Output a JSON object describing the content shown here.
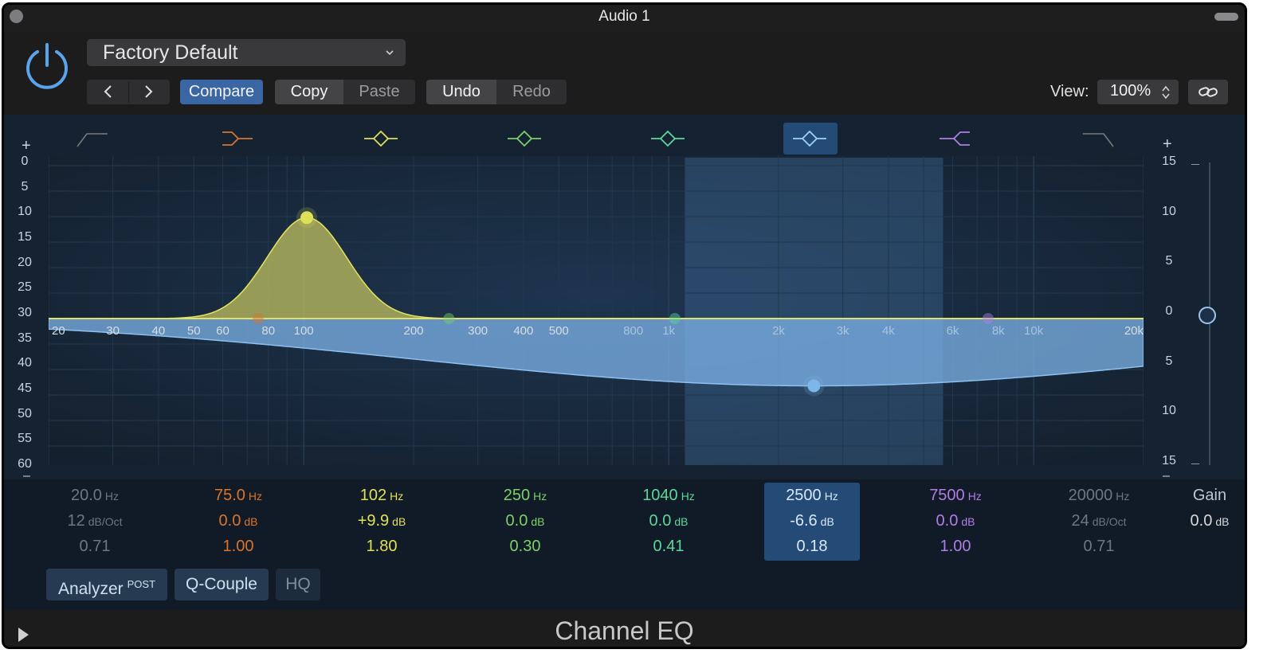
{
  "window": {
    "title": "Audio 1"
  },
  "header": {
    "preset": "Factory Default",
    "compare": "Compare",
    "copy": "Copy",
    "paste": "Paste",
    "undo": "Undo",
    "redo": "Redo",
    "view_label": "View:",
    "view_value": "100%"
  },
  "graph": {
    "plus_left": "+",
    "plus_right": "+",
    "minus_left": "–",
    "minus_right": "–",
    "left_scale": [
      "0",
      "5",
      "10",
      "15",
      "20",
      "25",
      "30",
      "35",
      "40",
      "45",
      "50",
      "55",
      "60"
    ],
    "right_scale": [
      "15",
      "10",
      "5",
      "0",
      "5",
      "10",
      "15"
    ],
    "freq_labels": [
      "20",
      "30",
      "40",
      "50",
      "60",
      "80",
      "100",
      "200",
      "300",
      "400",
      "500",
      "800",
      "1k",
      "2k",
      "3k",
      "4k",
      "6k",
      "8k",
      "10k",
      "20k"
    ],
    "freq_values": [
      20,
      30,
      40,
      50,
      60,
      80,
      100,
      200,
      300,
      400,
      500,
      800,
      1000,
      2000,
      3000,
      4000,
      6000,
      8000,
      10000,
      20000
    ],
    "selected_band": 6
  },
  "band_colors": [
    "#808080",
    "#d9742c",
    "#dfe05a",
    "#7bd169",
    "#5ed69b",
    "#7fb6ea",
    "#b07ee6",
    "#808080"
  ],
  "bands": [
    {
      "freq": "20.0",
      "freq_unit": "Hz",
      "gain": "12",
      "gain_unit": "dB/Oct",
      "q": "0.71",
      "freq_hz": 20,
      "gain_db": 0,
      "q_val": 0.71
    },
    {
      "freq": "75.0",
      "freq_unit": "Hz",
      "gain": "0.0",
      "gain_unit": "dB",
      "q": "1.00",
      "freq_hz": 75,
      "gain_db": 0,
      "q_val": 1.0
    },
    {
      "freq": "102",
      "freq_unit": "Hz",
      "gain": "+9.9",
      "gain_unit": "dB",
      "q": "1.80",
      "freq_hz": 102,
      "gain_db": 9.9,
      "q_val": 1.8
    },
    {
      "freq": "250",
      "freq_unit": "Hz",
      "gain": "0.0",
      "gain_unit": "dB",
      "q": "0.30",
      "freq_hz": 250,
      "gain_db": 0,
      "q_val": 0.3
    },
    {
      "freq": "1040",
      "freq_unit": "Hz",
      "gain": "0.0",
      "gain_unit": "dB",
      "q": "0.41",
      "freq_hz": 1040,
      "gain_db": 0,
      "q_val": 0.41
    },
    {
      "freq": "2500",
      "freq_unit": "Hz",
      "gain": "-6.6",
      "gain_unit": "dB",
      "q": "0.18",
      "freq_hz": 2500,
      "gain_db": -6.6,
      "q_val": 0.18
    },
    {
      "freq": "7500",
      "freq_unit": "Hz",
      "gain": "0.0",
      "gain_unit": "dB",
      "q": "1.00",
      "freq_hz": 7500,
      "gain_db": 0,
      "q_val": 1.0
    },
    {
      "freq": "20000",
      "freq_unit": "Hz",
      "gain": "24",
      "gain_unit": "dB/Oct",
      "q": "0.71",
      "freq_hz": 20000,
      "gain_db": 0,
      "q_val": 0.71
    }
  ],
  "gain_control": {
    "label": "Gain",
    "value": "0.0",
    "unit": "dB"
  },
  "analyzer": {
    "label": "Analyzer",
    "mode": "POST"
  },
  "q_couple": "Q-Couple",
  "hq": "HQ",
  "footer": {
    "title": "Channel EQ"
  }
}
